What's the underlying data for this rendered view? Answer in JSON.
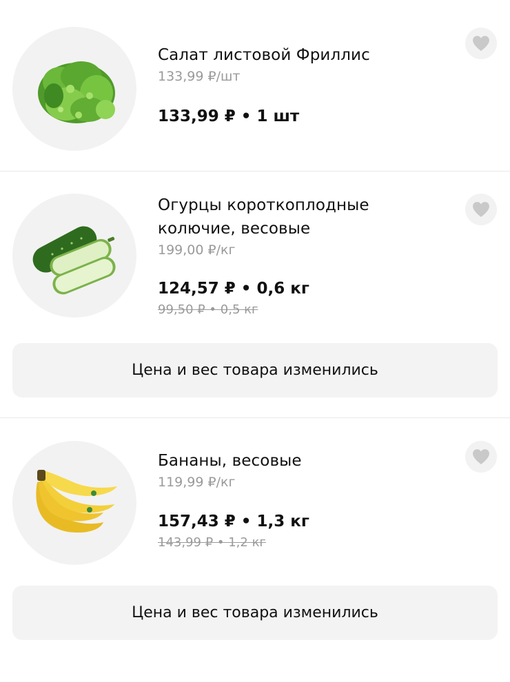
{
  "colors": {
    "background": "#ffffff",
    "circle": "#f2f2f2",
    "muted_text": "#9a9a9a",
    "heart": "#c9c9c9",
    "notice_bg": "#f3f3f3"
  },
  "products": [
    {
      "name": "Салат листовой Фриллис",
      "unit_price": "133,99 ₽/шт",
      "total": "133,99 ₽ • 1 шт",
      "image_icon": "lettuce-icon",
      "favorite_icon": "heart-icon"
    },
    {
      "name_line1": "Огурцы короткоплодные",
      "name_line2": "колючие, весовые",
      "unit_price": "199,00 ₽/кг",
      "total": "124,57 ₽ • 0,6 кг",
      "old_total": "99,50 ₽ • 0,5 кг",
      "notice": "Цена и вес товара изменились",
      "image_icon": "cucumber-icon",
      "favorite_icon": "heart-icon"
    },
    {
      "name": "Бананы, весовые",
      "unit_price": "119,99 ₽/кг",
      "total": "157,43 ₽ • 1,3 кг",
      "old_total": "143,99 ₽ • 1,2 кг",
      "notice": "Цена и вес товара изменились",
      "image_icon": "banana-icon",
      "favorite_icon": "heart-icon"
    }
  ]
}
